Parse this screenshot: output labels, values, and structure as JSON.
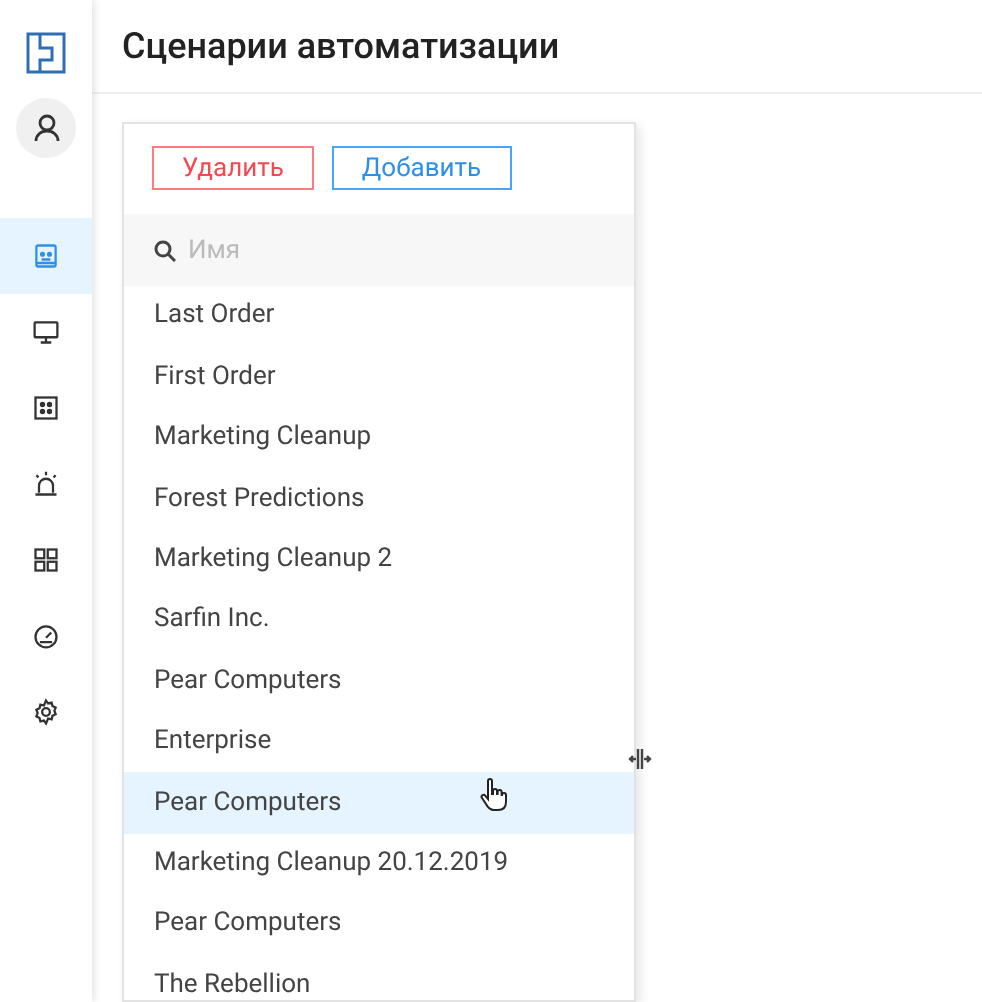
{
  "sidebar": {
    "nav": [
      {
        "kind": "robot",
        "selected": true
      },
      {
        "kind": "monitor",
        "selected": false
      },
      {
        "kind": "dots",
        "selected": false
      },
      {
        "kind": "alarm",
        "selected": false
      },
      {
        "kind": "apps",
        "selected": false
      },
      {
        "kind": "gauge",
        "selected": false
      },
      {
        "kind": "settings",
        "selected": false
      }
    ]
  },
  "header": {
    "title": "Сценарии автоматизации"
  },
  "panel": {
    "buttons": [
      {
        "label": "Удалить",
        "kind": "danger"
      },
      {
        "label": "Добавить",
        "kind": "primary"
      }
    ],
    "search": {
      "placeholder": "Имя"
    },
    "items": [
      {
        "label": "Last Order",
        "selected": false
      },
      {
        "label": "First Order",
        "selected": false
      },
      {
        "label": "Marketing Cleanup",
        "selected": false
      },
      {
        "label": "Forest Predictions",
        "selected": false
      },
      {
        "label": "Marketing Cleanup 2",
        "selected": false
      },
      {
        "label": "Sarfin Inc.",
        "selected": false
      },
      {
        "label": "Pear Computers",
        "selected": false
      },
      {
        "label": "Enterprise",
        "selected": false
      },
      {
        "label": "Pear Computers",
        "selected": true
      },
      {
        "label": "Marketing Cleanup 20.12.2019",
        "selected": false
      },
      {
        "label": "Pear Computers",
        "selected": false
      },
      {
        "label": "The Rebellion",
        "selected": false
      }
    ]
  }
}
